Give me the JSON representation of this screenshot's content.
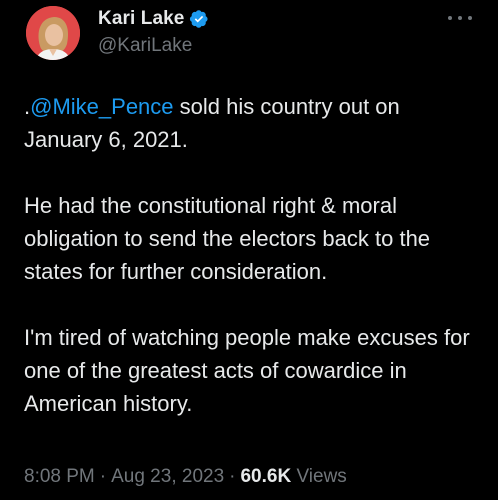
{
  "author": {
    "display_name": "Kari Lake",
    "handle": "@KariLake",
    "verified": true
  },
  "tweet": {
    "paragraph1": {
      "prefix": ".",
      "mention": "@Mike_Pence",
      "rest": " sold his country out on January 6, 2021."
    },
    "paragraph2": "He had the constitutional right & moral obligation to send the electors back to the states for further consideration.",
    "paragraph3": "I'm tired of watching people make excuses for one of the greatest acts of cowardice in American history."
  },
  "meta": {
    "time": "8:08 PM",
    "separator": "·",
    "date": "Aug 23, 2023",
    "views_count": "60.6K",
    "views_label": "Views"
  },
  "colors": {
    "background": "#000000",
    "text": "#e7e9ea",
    "secondary": "#71767b",
    "accent": "#1d9bf0",
    "avatar_bg": "#e64a4a"
  },
  "icons": {
    "verified": "verified-badge-icon",
    "more": "more-options-icon"
  }
}
